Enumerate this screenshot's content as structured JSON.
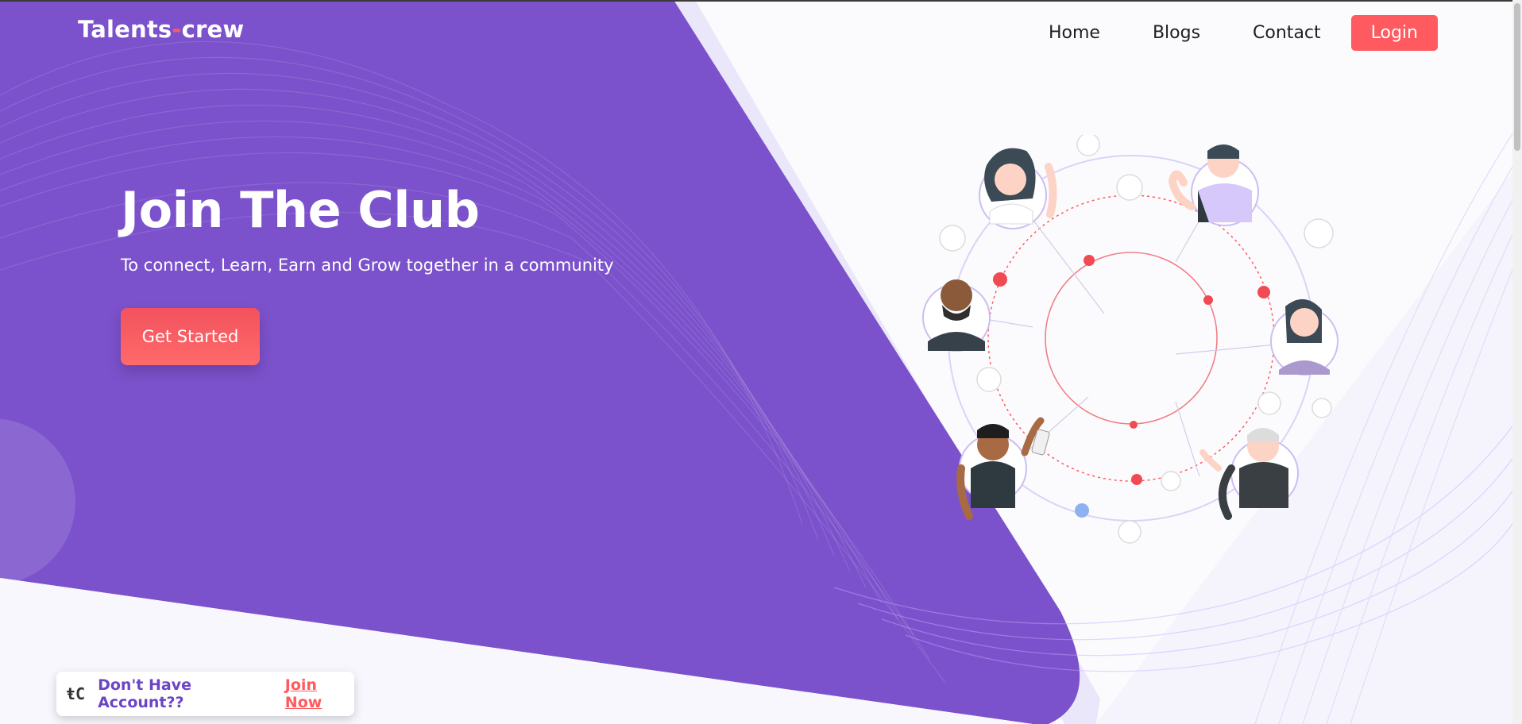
{
  "brand": {
    "name_part1": "Talents",
    "separator": "-",
    "name_part2": "crew"
  },
  "nav": {
    "items": [
      "Home",
      "Blogs",
      "Contact"
    ],
    "login_label": "Login"
  },
  "hero": {
    "title": "Join The Club",
    "subtitle": "To connect, Learn, Earn and Grow together in a community",
    "cta_label": "Get Started"
  },
  "footer_card": {
    "logo_text": "ŧC",
    "message": "Don't Have Account??",
    "link_label": "Join Now"
  },
  "colors": {
    "primary_purple": "#7b52cb",
    "accent_red": "#ff5a5f",
    "light_lavender": "#f5f4fd"
  },
  "icons": [
    "community-network-illustration",
    "music-icon",
    "cloud-icon",
    "like-icon",
    "user-icon",
    "mail-icon",
    "play-icon",
    "wifi-icon",
    "star-icon",
    "location-pin-icon"
  ]
}
